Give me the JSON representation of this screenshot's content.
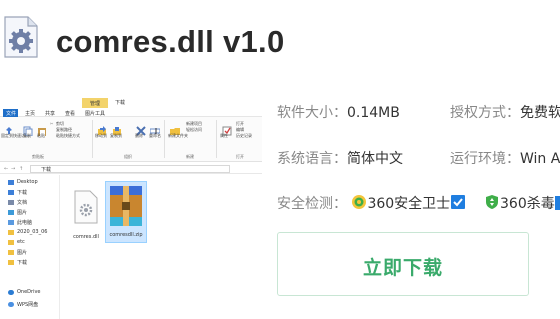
{
  "header": {
    "title": "comres.dll v1.0",
    "icon": "dll-gear-icon"
  },
  "explorer": {
    "context_tab": "管理",
    "download_tab": "下载",
    "menu": [
      "文件",
      "主页",
      "共享",
      "查看",
      "图片工具"
    ],
    "ribbon": {
      "pin": "固定到快速访问",
      "copy": "复制",
      "paste": "粘贴",
      "cut": "剪切",
      "copy_path": "复制路径",
      "paste_shortcut": "粘贴快捷方式",
      "move_to": "移动到",
      "copy_to": "复制到",
      "delete": "删除",
      "rename": "重命名",
      "new_folder": "新建文件夹",
      "new_item": "新建项目",
      "easy_access": "轻松访问",
      "properties": "属性",
      "open": "打开",
      "edit": "编辑",
      "history": "历史记录",
      "group_clipboard": "剪贴板",
      "group_organize": "组织",
      "group_new": "新建",
      "group_open": "打开"
    },
    "address": "下载",
    "sidebar": [
      "Desktop",
      "下载",
      "文档",
      "图片",
      "此电脑",
      "2020_03_06",
      "etc",
      "图片",
      "下载",
      "OneDrive",
      "WPS网盘"
    ],
    "files": [
      {
        "name": "comres.dll",
        "icon": "dll-file-icon"
      },
      {
        "name": "comresdll.zip",
        "icon": "zip-archive-icon"
      }
    ]
  },
  "info": {
    "size_label": "软件大小：",
    "size_value": "0.14MB",
    "license_label": "授权方式：",
    "license_value": "免费软",
    "language_label": "系统语言：",
    "language_value": "简体中文",
    "env_label": "运行环境：",
    "env_value": "Win A",
    "security_label": "安全检测：",
    "security_badges": [
      {
        "label": "360安全卫士",
        "icon": "360-guard-icon"
      },
      {
        "label": "360杀毒",
        "icon": "360-antivirus-icon"
      }
    ]
  },
  "download_button": "立即下载",
  "colors": {
    "download_green": "#3aaa6b",
    "file_tab_blue": "#1e6ec8",
    "context_tab_yellow": "#f3d36b"
  }
}
